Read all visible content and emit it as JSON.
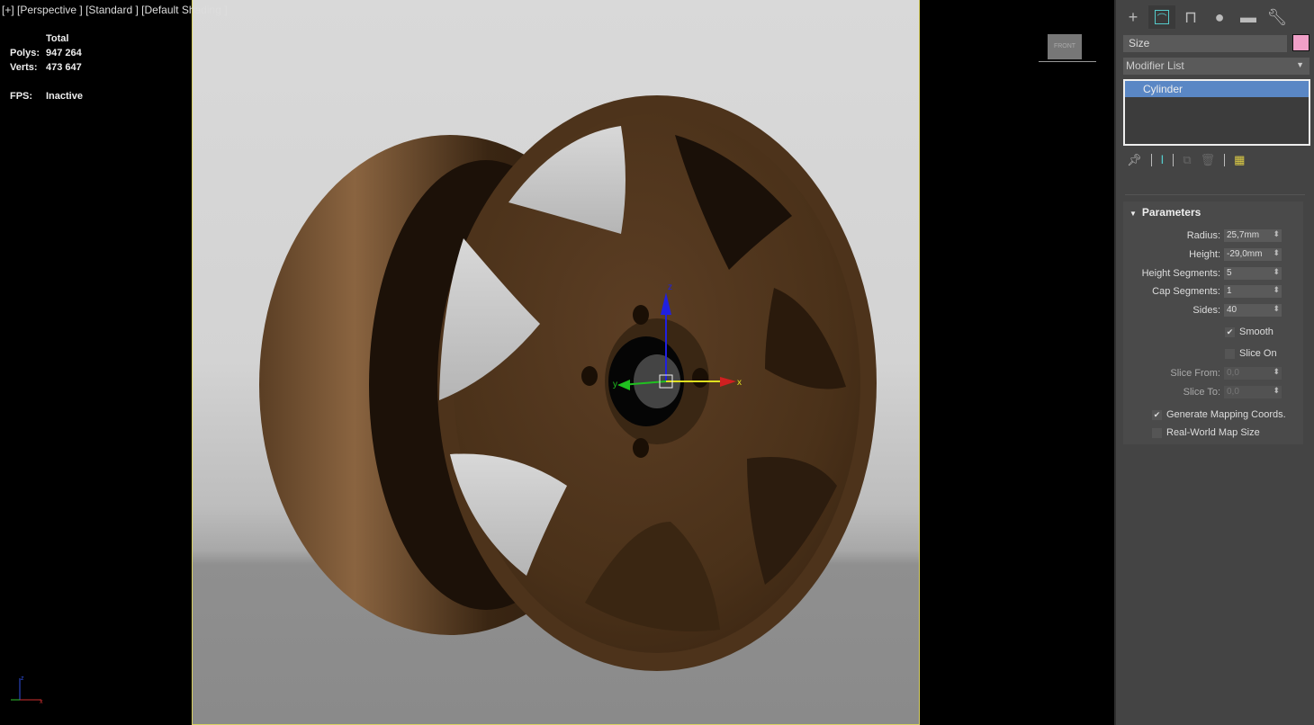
{
  "viewport": {
    "label": [
      "[+]",
      "[Perspective ]",
      "[Standard ]",
      "[Default Shading ]"
    ],
    "stats": {
      "header": "Total",
      "polys_label": "Polys:",
      "polys": "947 264",
      "verts_label": "Verts:",
      "verts": "473 647",
      "fps_label": "FPS:",
      "fps": "Inactive"
    },
    "viewcube_face": "FRONT",
    "gizmo": {
      "x": "x",
      "y": "y",
      "z": "z"
    }
  },
  "panel": {
    "tabs": [
      "create",
      "modify",
      "hierarchy",
      "motion",
      "display",
      "utilities"
    ],
    "object_name": "Size",
    "object_color": "#f0a0c8",
    "modifier_list": "Modifier List",
    "stack": [
      "Cylinder"
    ],
    "rollout_title": "Parameters",
    "params": [
      {
        "label": "Radius:",
        "value": "25,7mm"
      },
      {
        "label": "Height:",
        "value": "-29,0mm"
      },
      {
        "label": "Height Segments:",
        "value": "5"
      },
      {
        "label": "Cap Segments:",
        "value": "1"
      },
      {
        "label": "Sides:",
        "value": "40"
      }
    ],
    "smooth": "Smooth",
    "slice_on": "Slice On",
    "slice_from": {
      "label": "Slice From:",
      "value": "0,0"
    },
    "slice_to": {
      "label": "Slice To:",
      "value": "0,0"
    },
    "gen_map": "Generate Mapping Coords.",
    "real_world": "Real-World Map Size"
  }
}
